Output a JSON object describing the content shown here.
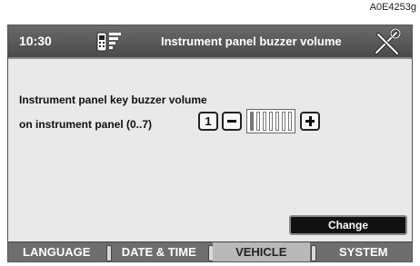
{
  "reference_code": "A0E4253g",
  "header": {
    "clock": "10:30",
    "title": "Instrument panel buzzer volume",
    "left_icon": "phone-signal-icon",
    "right_icon": "tools-icon"
  },
  "setting": {
    "label_line1": "Instrument panel key buzzer volume",
    "label_line2": "on instrument panel (0..7)",
    "value": "1",
    "level_fraction": 0.142857,
    "segments": 7
  },
  "buttons": {
    "change": "Change"
  },
  "tabs": [
    {
      "label": "LANGUAGE",
      "active": false
    },
    {
      "label": "DATE & TIME",
      "active": false
    },
    {
      "label": "VEHICLE",
      "active": true
    },
    {
      "label": "SYSTEM",
      "active": false
    }
  ]
}
